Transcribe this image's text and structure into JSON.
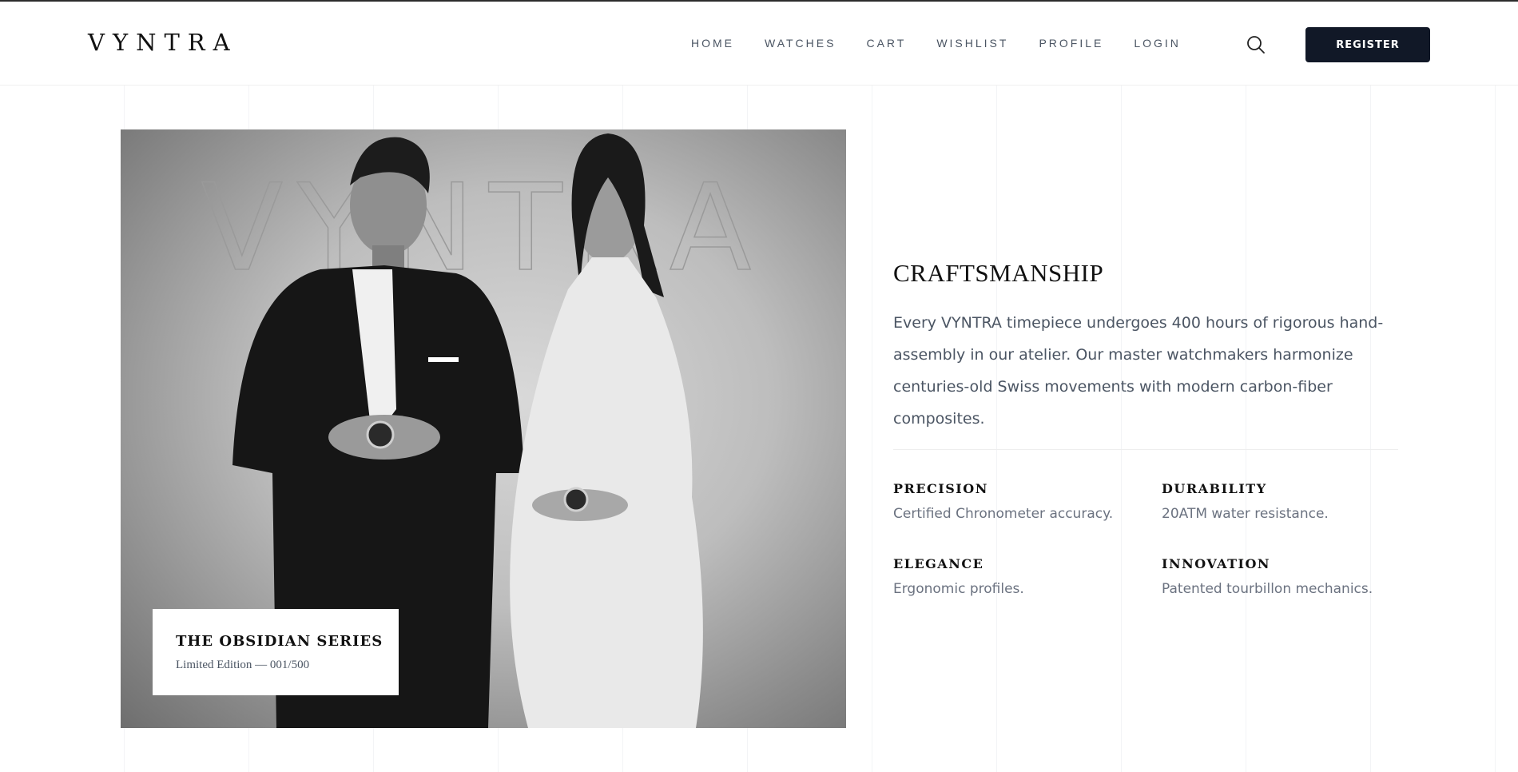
{
  "header": {
    "logo": "VYNTRA",
    "nav": [
      "HOME",
      "WATCHES",
      "CART",
      "WISHLIST",
      "PROFILE",
      "LOGIN"
    ],
    "search_icon": "search-icon",
    "register_label": "REGISTER"
  },
  "hero_image": {
    "watermark_text": "VYNTRA",
    "caption_title": "THE OBSIDIAN SERIES",
    "caption_subtitle": "Limited Edition — 001/500"
  },
  "craftsmanship": {
    "title": "CRAFTSMANSHIP",
    "body": "Every VYNTRA timepiece undergoes 400 hours of rigorous hand-assembly in our atelier. Our master watchmakers harmonize centuries-old Swiss movements with modern carbon-fiber composites.",
    "features": [
      {
        "title": "PRECISION",
        "desc": "Certified Chronometer accuracy."
      },
      {
        "title": "DURABILITY",
        "desc": "20ATM water resistance."
      },
      {
        "title": "ELEGANCE",
        "desc": "Ergonomic profiles."
      },
      {
        "title": "INNOVATION",
        "desc": "Patented tourbillon mechanics."
      }
    ]
  },
  "colors": {
    "primary_button": "#111827",
    "text_dark": "#111111",
    "text_muted": "#6b7280"
  }
}
